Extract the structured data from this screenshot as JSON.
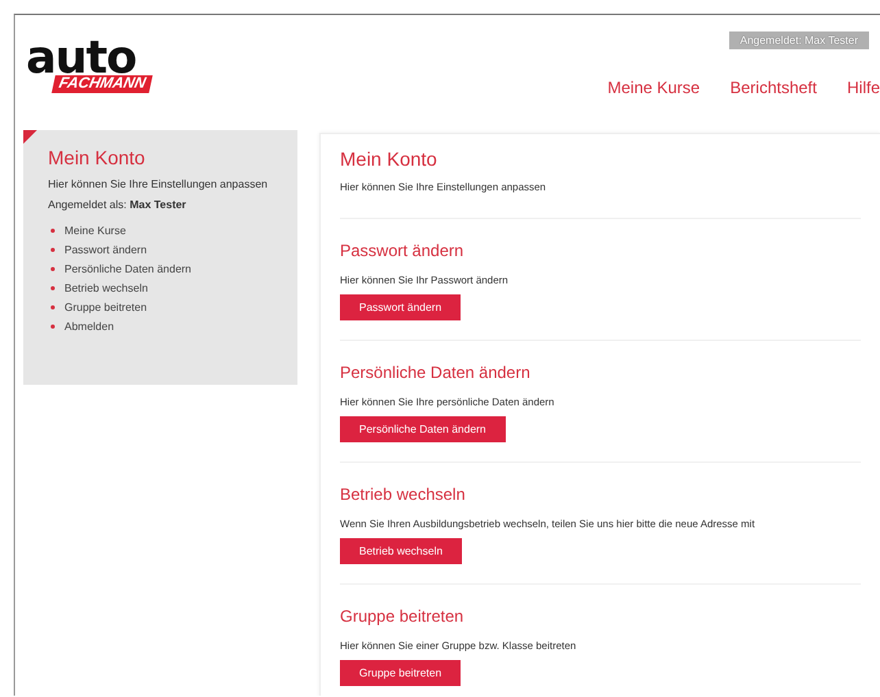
{
  "header": {
    "logo": {
      "top": "auto",
      "bottom": "FACHMANN"
    },
    "user_button": "Angemeldet: Max Tester",
    "nav": [
      "Meine Kurse",
      "Berichtsheft",
      "Hilfe"
    ]
  },
  "sidebar": {
    "title": "Mein Konto",
    "intro": "Hier können Sie Ihre Einstellungen anpassen",
    "login_label": "Angemeldet als:",
    "login_name": "Max Tester",
    "items": [
      "Meine Kurse",
      "Passwort ändern",
      "Persönliche Daten ändern",
      "Betrieb wechseln",
      "Gruppe beitreten",
      "Abmelden"
    ]
  },
  "main": {
    "title": "Mein Konto",
    "intro": "Hier können Sie Ihre Einstellungen anpassen",
    "sections": [
      {
        "heading": "Passwort ändern",
        "text": "Hier können Sie Ihr Passwort ändern",
        "button": "Passwort ändern"
      },
      {
        "heading": "Persönliche Daten ändern",
        "text": "Hier können Sie Ihre persönliche Daten ändern",
        "button": "Persönliche Daten ändern"
      },
      {
        "heading": "Betrieb wechseln",
        "text": "Wenn Sie Ihren Ausbildungsbetrieb wechseln, teilen Sie uns hier bitte die neue Adresse mit",
        "button": "Betrieb wechseln"
      },
      {
        "heading": "Gruppe beitreten",
        "text": "Hier können Sie einer Gruppe bzw. Klasse beitreten",
        "button": "Gruppe beitreten"
      }
    ]
  }
}
